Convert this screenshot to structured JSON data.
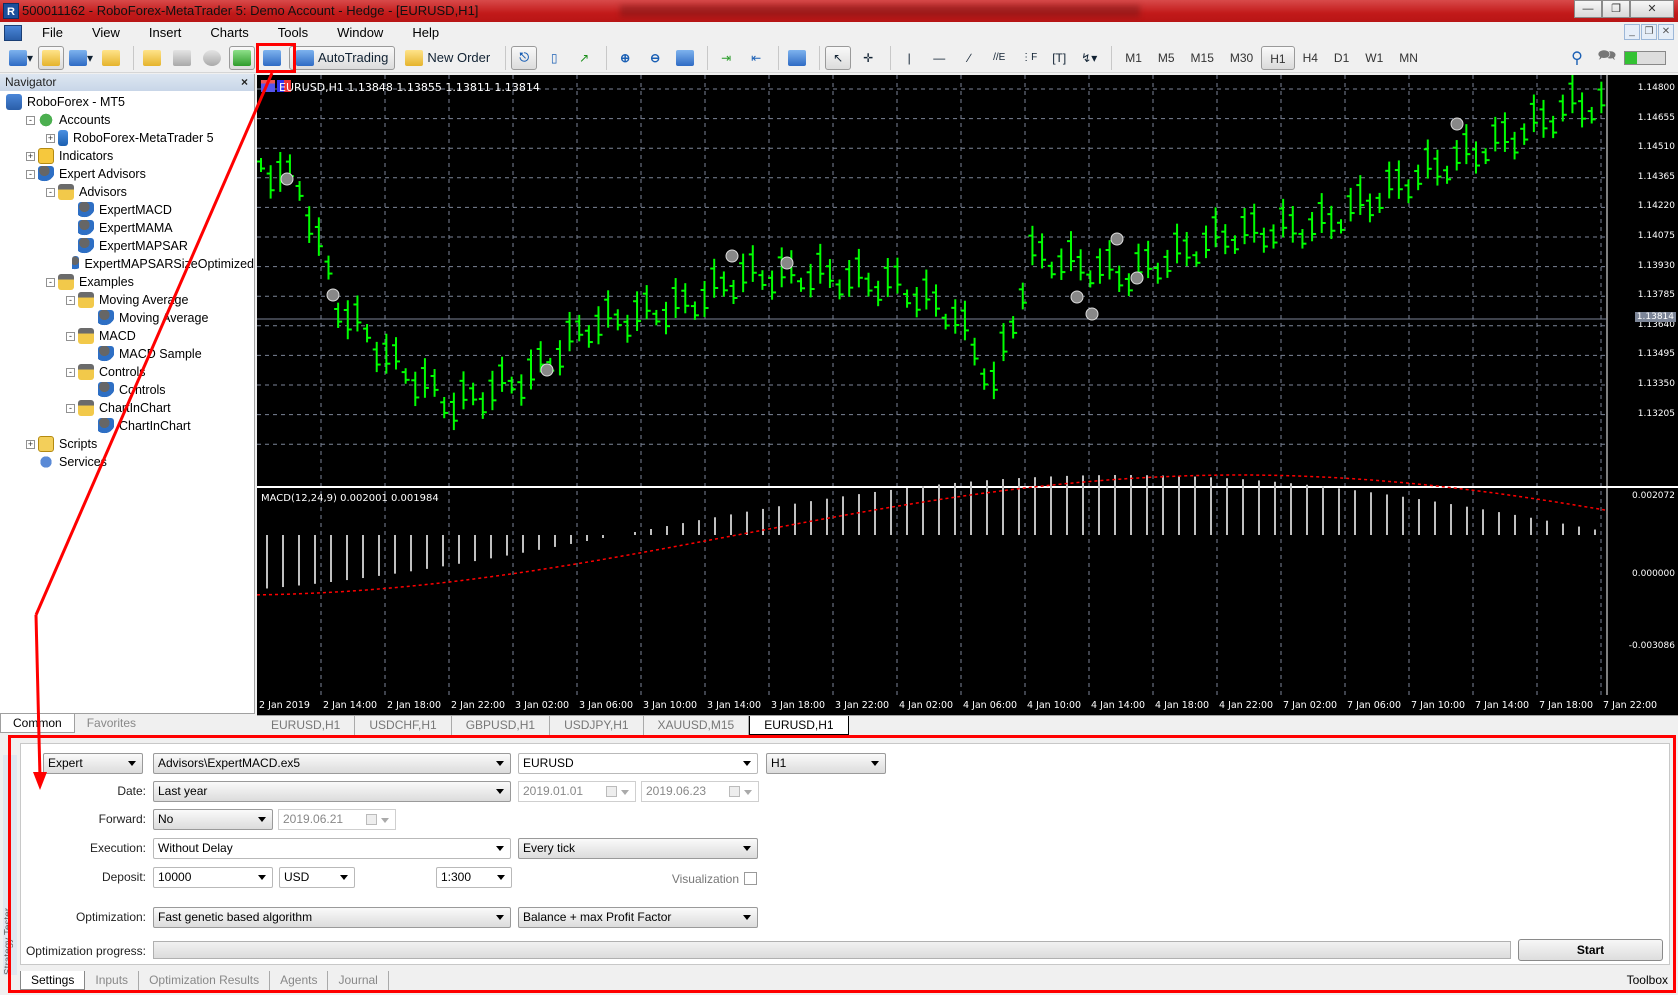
{
  "window": {
    "title": "500011162 - RoboForex-MetaTrader 5: Demo Account - Hedge - [EURUSD,H1]",
    "app_icon": "metatrader-icon",
    "controls": [
      "minimize",
      "restore",
      "close"
    ]
  },
  "menu": [
    "File",
    "View",
    "Insert",
    "Charts",
    "Tools",
    "Window",
    "Help"
  ],
  "toolbar": {
    "autotrading_label": "AutoTrading",
    "new_order_label": "New Order",
    "timeframes": [
      "M1",
      "M5",
      "M15",
      "M30",
      "H1",
      "H4",
      "D1",
      "W1",
      "MN"
    ],
    "active_timeframe": "H1",
    "highlighted_button": "strategy-tester-button"
  },
  "navigator": {
    "title": "Navigator",
    "tree": [
      {
        "label": "RoboForex - MT5",
        "level": 0,
        "icon": "terminal-icon",
        "exp": ""
      },
      {
        "label": "Accounts",
        "level": 1,
        "icon": "accounts-icon",
        "exp": "-"
      },
      {
        "label": "RoboForex-MetaTrader 5",
        "level": 2,
        "icon": "server-icon",
        "exp": "+"
      },
      {
        "label": "Indicators",
        "level": 1,
        "icon": "indicators-icon",
        "exp": "+"
      },
      {
        "label": "Expert Advisors",
        "level": 1,
        "icon": "expert-icon",
        "exp": "-"
      },
      {
        "label": "Advisors",
        "level": 2,
        "icon": "expert-folder-icon",
        "exp": "-"
      },
      {
        "label": "ExpertMACD",
        "level": 3,
        "icon": "expert-icon",
        "exp": ""
      },
      {
        "label": "ExpertMAMA",
        "level": 3,
        "icon": "expert-icon",
        "exp": ""
      },
      {
        "label": "ExpertMAPSAR",
        "level": 3,
        "icon": "expert-icon",
        "exp": ""
      },
      {
        "label": "ExpertMAPSARSizeOptimized",
        "level": 3,
        "icon": "expert-icon",
        "exp": ""
      },
      {
        "label": "Examples",
        "level": 2,
        "icon": "expert-folder-icon",
        "exp": "-"
      },
      {
        "label": "Moving Average",
        "level": 3,
        "icon": "expert-folder-icon",
        "exp": "-"
      },
      {
        "label": "Moving Average",
        "level": 4,
        "icon": "expert-icon",
        "exp": ""
      },
      {
        "label": "MACD",
        "level": 3,
        "icon": "expert-folder-icon",
        "exp": "-"
      },
      {
        "label": "MACD Sample",
        "level": 4,
        "icon": "expert-icon",
        "exp": ""
      },
      {
        "label": "Controls",
        "level": 3,
        "icon": "expert-folder-icon",
        "exp": "-"
      },
      {
        "label": "Controls",
        "level": 4,
        "icon": "expert-icon",
        "exp": ""
      },
      {
        "label": "ChartInChart",
        "level": 3,
        "icon": "expert-folder-icon",
        "exp": "-"
      },
      {
        "label": "ChartInChart",
        "level": 4,
        "icon": "expert-icon",
        "exp": ""
      },
      {
        "label": "Scripts",
        "level": 1,
        "icon": "scripts-icon",
        "exp": "+"
      },
      {
        "label": "Services",
        "level": 1,
        "icon": "services-icon",
        "exp": ""
      }
    ],
    "tabs": [
      "Common",
      "Favorites"
    ],
    "active_tab": "Common"
  },
  "chart": {
    "header": "EURUSD,H1  1.13848 1.13855 1.13811 1.13814",
    "current_price": "1.13814",
    "price_labels": [
      "1.14800",
      "1.14655",
      "1.14510",
      "1.14365",
      "1.14220",
      "1.14075",
      "1.13930",
      "1.13785",
      "1.13640",
      "1.13495",
      "1.13350",
      "1.13205"
    ],
    "macd_label": "MACD(12,24,9) 0.002001 0.001984",
    "macd_labels": [
      "0.002072",
      "0.000000",
      "-0.003086"
    ],
    "time_labels": [
      "2 Jan 2019",
      "2 Jan 14:00",
      "2 Jan 18:00",
      "2 Jan 22:00",
      "3 Jan 02:00",
      "3 Jan 06:00",
      "3 Jan 10:00",
      "3 Jan 14:00",
      "3 Jan 18:00",
      "3 Jan 22:00",
      "4 Jan 02:00",
      "4 Jan 06:00",
      "4 Jan 10:00",
      "4 Jan 14:00",
      "4 Jan 18:00",
      "4 Jan 22:00",
      "7 Jan 02:00",
      "7 Jan 06:00",
      "7 Jan 10:00",
      "7 Jan 14:00",
      "7 Jan 18:00",
      "7 Jan 22:00"
    ],
    "colors": {
      "bars": "#00ff00",
      "background": "#000000",
      "grid": "#7c8597",
      "signal": "#ff0000",
      "histogram": "#c0c0c0"
    },
    "tabs": [
      "EURUSD,H1",
      "USDCHF,H1",
      "GBPUSD,H1",
      "USDJPY,H1",
      "XAUUSD,M15",
      "EURUSD,H1"
    ],
    "active_tab_index": 5
  },
  "tester": {
    "side_label": "Strategy Tester",
    "type_value": "Expert",
    "expert_value": "Advisors\\ExpertMACD.ex5",
    "symbol_value": "EURUSD",
    "period_value": "H1",
    "date_label": "Date:",
    "date_value": "Last year",
    "date_from": "2019.01.01",
    "date_to": "2019.06.23",
    "forward_label": "Forward:",
    "forward_value": "No",
    "forward_date": "2019.06.21",
    "execution_label": "Execution:",
    "execution_value": "Without Delay",
    "model_value": "Every tick",
    "deposit_label": "Deposit:",
    "deposit_value": "10000",
    "currency_value": "USD",
    "leverage_value": "1:300",
    "visualization_label": "Visualization",
    "visualization_checked": false,
    "optimization_label": "Optimization:",
    "optimization_value": "Fast genetic based algorithm",
    "criterion_value": "Balance + max Profit Factor",
    "progress_label": "Optimization progress:",
    "progress": 0,
    "start_label": "Start",
    "tabs": [
      "Settings",
      "Inputs",
      "Optimization Results",
      "Agents",
      "Journal"
    ],
    "active_tab": "Settings",
    "toolbox_label": "Toolbox"
  }
}
